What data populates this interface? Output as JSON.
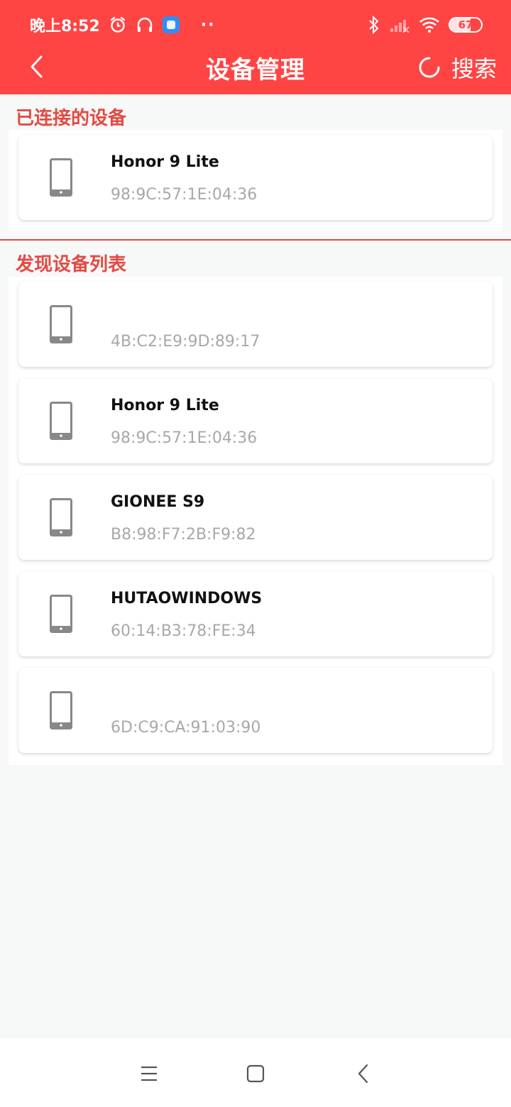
{
  "colors": {
    "accent": "#ff4444",
    "section": "#e24b43",
    "mac_text": "#a8a8a8"
  },
  "status_bar": {
    "time": "晚上8:52",
    "overflow": "··",
    "battery_level": 67,
    "battery_text": "67",
    "icons": [
      "alarm-icon",
      "headphones-icon",
      "app-notification-icon",
      "bluetooth-icon",
      "signal-icon",
      "wifi-icon",
      "battery-icon"
    ]
  },
  "header": {
    "title": "设备管理",
    "search_label": "搜索"
  },
  "connected": {
    "heading": "已连接的设备",
    "devices": [
      {
        "name": "Honor 9 Lite",
        "mac": "98:9C:57:1E:04:36"
      }
    ]
  },
  "discovered": {
    "heading": "发现设备列表",
    "devices": [
      {
        "name": "",
        "mac": "4B:C2:E9:9D:89:17"
      },
      {
        "name": "Honor 9 Lite",
        "mac": "98:9C:57:1E:04:36"
      },
      {
        "name": "GIONEE S9",
        "mac": "B8:98:F7:2B:F9:82"
      },
      {
        "name": "HUTAOWINDOWS",
        "mac": "60:14:B3:78:FE:34"
      },
      {
        "name": "",
        "mac": "6D:C9:CA:91:03:90"
      }
    ]
  },
  "system_nav": {
    "icons": [
      "menu-icon",
      "home-icon",
      "back-icon"
    ]
  }
}
